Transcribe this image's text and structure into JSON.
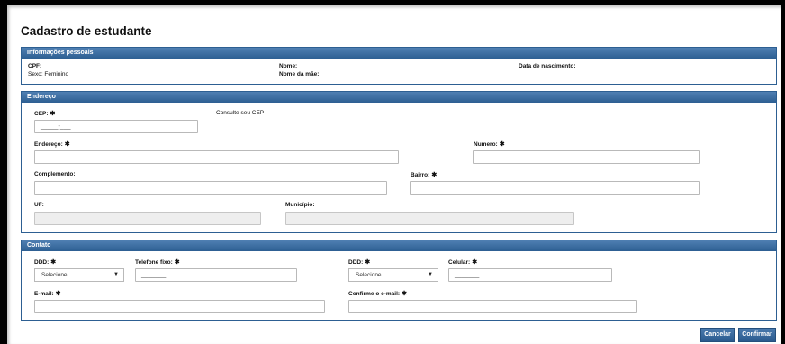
{
  "page_title": "Cadastro de estudante",
  "personal": {
    "header": "Informações pessoais",
    "cpf_label": "CPF:",
    "sexo_label": "Sexo: Feminino",
    "nome_label": "Nome:",
    "nome_mae_label": "Nome da mãe:",
    "nascimento_label": "Data de nascimento:"
  },
  "address": {
    "header": "Endereço",
    "cep_label": "CEP:",
    "cep_value": "_____-___",
    "consult_link": "Consulte seu CEP",
    "endereco_label": "Endereço:",
    "numero_label": "Numero:",
    "complemento_label": "Complemento:",
    "bairro_label": "Bairro:",
    "uf_label": "UF:",
    "municipio_label": "Município:"
  },
  "contact": {
    "header": "Contato",
    "ddd1_label": "DDD:",
    "ddd1_value": "Selecione",
    "telefone_label": "Telefone fixo:",
    "telefone_value": "_______",
    "ddd2_label": "DDD:",
    "ddd2_value": "Selecione",
    "celular_label": "Celular:",
    "celular_value": "_______",
    "email_label": "E-mail:",
    "confirm_email_label": "Confirme o e-mail:"
  },
  "required_mark": "✱",
  "buttons": {
    "cancel": "Cancelar",
    "confirm": "Confirmar"
  },
  "colors": {
    "header_blue": "#2d5f92",
    "button_blue": "#3a6a9e"
  }
}
